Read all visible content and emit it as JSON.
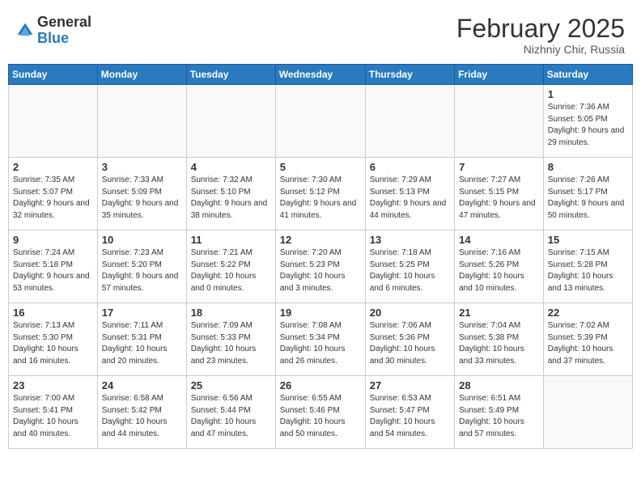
{
  "header": {
    "logo_general": "General",
    "logo_blue": "Blue",
    "month_title": "February 2025",
    "subtitle": "Nizhniy Chir, Russia"
  },
  "weekdays": [
    "Sunday",
    "Monday",
    "Tuesday",
    "Wednesday",
    "Thursday",
    "Friday",
    "Saturday"
  ],
  "weeks": [
    [
      {
        "day": "",
        "info": ""
      },
      {
        "day": "",
        "info": ""
      },
      {
        "day": "",
        "info": ""
      },
      {
        "day": "",
        "info": ""
      },
      {
        "day": "",
        "info": ""
      },
      {
        "day": "",
        "info": ""
      },
      {
        "day": "1",
        "info": "Sunrise: 7:36 AM\nSunset: 5:05 PM\nDaylight: 9 hours and 29 minutes."
      }
    ],
    [
      {
        "day": "2",
        "info": "Sunrise: 7:35 AM\nSunset: 5:07 PM\nDaylight: 9 hours and 32 minutes."
      },
      {
        "day": "3",
        "info": "Sunrise: 7:33 AM\nSunset: 5:09 PM\nDaylight: 9 hours and 35 minutes."
      },
      {
        "day": "4",
        "info": "Sunrise: 7:32 AM\nSunset: 5:10 PM\nDaylight: 9 hours and 38 minutes."
      },
      {
        "day": "5",
        "info": "Sunrise: 7:30 AM\nSunset: 5:12 PM\nDaylight: 9 hours and 41 minutes."
      },
      {
        "day": "6",
        "info": "Sunrise: 7:29 AM\nSunset: 5:13 PM\nDaylight: 9 hours and 44 minutes."
      },
      {
        "day": "7",
        "info": "Sunrise: 7:27 AM\nSunset: 5:15 PM\nDaylight: 9 hours and 47 minutes."
      },
      {
        "day": "8",
        "info": "Sunrise: 7:26 AM\nSunset: 5:17 PM\nDaylight: 9 hours and 50 minutes."
      }
    ],
    [
      {
        "day": "9",
        "info": "Sunrise: 7:24 AM\nSunset: 5:18 PM\nDaylight: 9 hours and 53 minutes."
      },
      {
        "day": "10",
        "info": "Sunrise: 7:23 AM\nSunset: 5:20 PM\nDaylight: 9 hours and 57 minutes."
      },
      {
        "day": "11",
        "info": "Sunrise: 7:21 AM\nSunset: 5:22 PM\nDaylight: 10 hours and 0 minutes."
      },
      {
        "day": "12",
        "info": "Sunrise: 7:20 AM\nSunset: 5:23 PM\nDaylight: 10 hours and 3 minutes."
      },
      {
        "day": "13",
        "info": "Sunrise: 7:18 AM\nSunset: 5:25 PM\nDaylight: 10 hours and 6 minutes."
      },
      {
        "day": "14",
        "info": "Sunrise: 7:16 AM\nSunset: 5:26 PM\nDaylight: 10 hours and 10 minutes."
      },
      {
        "day": "15",
        "info": "Sunrise: 7:15 AM\nSunset: 5:28 PM\nDaylight: 10 hours and 13 minutes."
      }
    ],
    [
      {
        "day": "16",
        "info": "Sunrise: 7:13 AM\nSunset: 5:30 PM\nDaylight: 10 hours and 16 minutes."
      },
      {
        "day": "17",
        "info": "Sunrise: 7:11 AM\nSunset: 5:31 PM\nDaylight: 10 hours and 20 minutes."
      },
      {
        "day": "18",
        "info": "Sunrise: 7:09 AM\nSunset: 5:33 PM\nDaylight: 10 hours and 23 minutes."
      },
      {
        "day": "19",
        "info": "Sunrise: 7:08 AM\nSunset: 5:34 PM\nDaylight: 10 hours and 26 minutes."
      },
      {
        "day": "20",
        "info": "Sunrise: 7:06 AM\nSunset: 5:36 PM\nDaylight: 10 hours and 30 minutes."
      },
      {
        "day": "21",
        "info": "Sunrise: 7:04 AM\nSunset: 5:38 PM\nDaylight: 10 hours and 33 minutes."
      },
      {
        "day": "22",
        "info": "Sunrise: 7:02 AM\nSunset: 5:39 PM\nDaylight: 10 hours and 37 minutes."
      }
    ],
    [
      {
        "day": "23",
        "info": "Sunrise: 7:00 AM\nSunset: 5:41 PM\nDaylight: 10 hours and 40 minutes."
      },
      {
        "day": "24",
        "info": "Sunrise: 6:58 AM\nSunset: 5:42 PM\nDaylight: 10 hours and 44 minutes."
      },
      {
        "day": "25",
        "info": "Sunrise: 6:56 AM\nSunset: 5:44 PM\nDaylight: 10 hours and 47 minutes."
      },
      {
        "day": "26",
        "info": "Sunrise: 6:55 AM\nSunset: 5:46 PM\nDaylight: 10 hours and 50 minutes."
      },
      {
        "day": "27",
        "info": "Sunrise: 6:53 AM\nSunset: 5:47 PM\nDaylight: 10 hours and 54 minutes."
      },
      {
        "day": "28",
        "info": "Sunrise: 6:51 AM\nSunset: 5:49 PM\nDaylight: 10 hours and 57 minutes."
      },
      {
        "day": "",
        "info": ""
      }
    ]
  ]
}
